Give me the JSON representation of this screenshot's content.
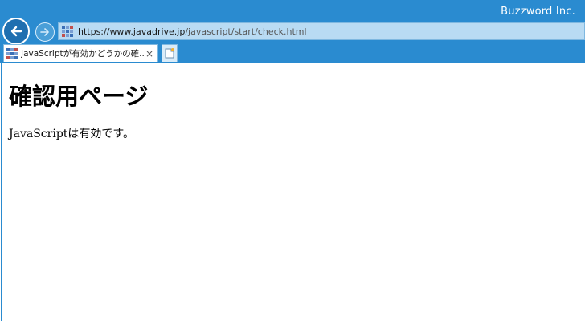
{
  "window": {
    "company": "Buzzword Inc."
  },
  "nav": {
    "back_icon": "back-arrow-icon",
    "forward_icon": "forward-arrow-icon"
  },
  "address": {
    "scheme": "https://",
    "domain": "www.javadrive.jp",
    "path": "/javascript/start/check.html",
    "site_icon": "site-favicon-icon"
  },
  "tab": {
    "label": "JavaScriptが有効かどうかの確...",
    "close_label": "×",
    "new_tab_icon": "new-tab-icon"
  },
  "page": {
    "title": "確認用ページ",
    "text": "JavaScriptは有効です。"
  },
  "colors": {
    "titlebar": "#2a8bd0",
    "addressbar": "#b9dbf3"
  }
}
